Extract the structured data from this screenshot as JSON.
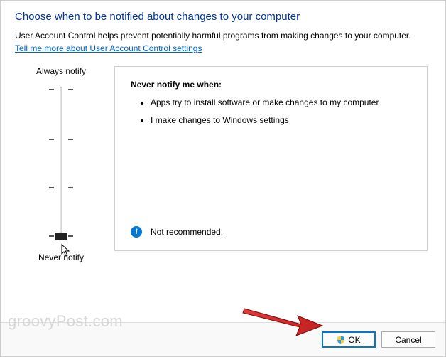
{
  "title": "Choose when to be notified about changes to your computer",
  "subtitle": "User Account Control helps prevent potentially harmful programs from making changes to your computer.",
  "link": "Tell me more about User Account Control settings",
  "slider": {
    "top_label": "Always notify",
    "bottom_label": "Never notify"
  },
  "info": {
    "heading": "Never notify me when:",
    "bullets": [
      "Apps try to install software or make changes to my computer",
      "I make changes to Windows settings"
    ],
    "recommendation": "Not recommended."
  },
  "buttons": {
    "ok": "OK",
    "cancel": "Cancel"
  },
  "watermark": "groovyPost.com"
}
